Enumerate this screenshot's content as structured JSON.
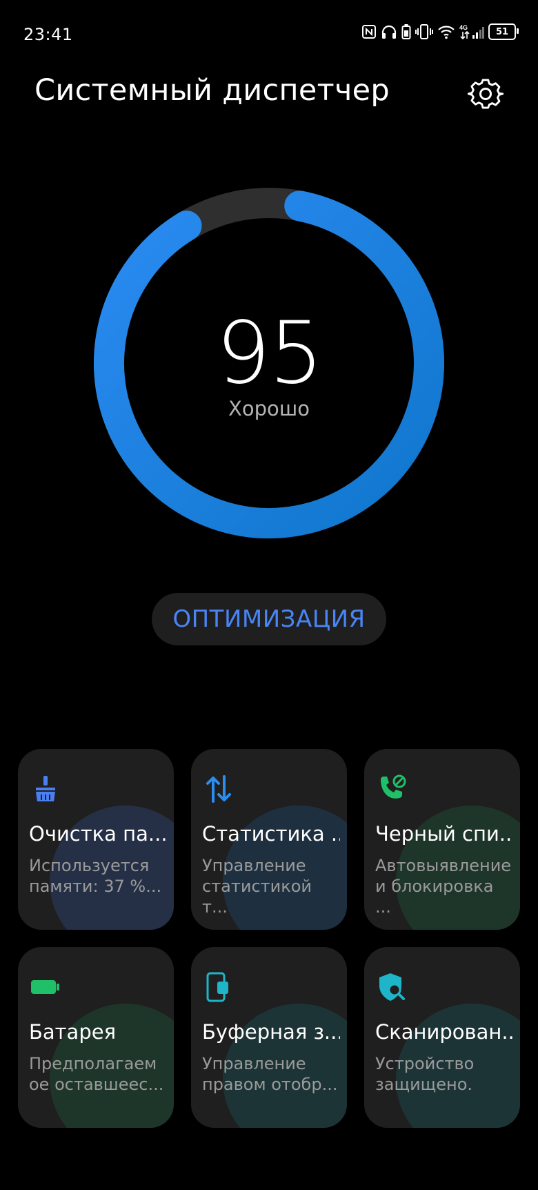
{
  "status_bar": {
    "time": "23:41",
    "battery_level": "51",
    "icons": [
      "nfc-icon",
      "headphones-icon",
      "battery-saver-icon",
      "vibrate-icon",
      "wifi-icon",
      "4g-signal-icon",
      "cell-signal-icon",
      "battery-icon"
    ],
    "network_label": "4G"
  },
  "header": {
    "title": "Системный диспетчер",
    "settings_icon": "gear-icon"
  },
  "score_gauge": {
    "value": "95",
    "status": "Хорошо",
    "fill_fraction": 0.95,
    "colors": {
      "track": "#2f2f2f",
      "fill_start": "#2a87f0",
      "fill_end": "#137bd3"
    }
  },
  "optimize_button": {
    "label": "ОПТИМИЗАЦИЯ",
    "color": "#4a85f5"
  },
  "tiles": [
    {
      "title": "Очистка па...",
      "subtitle_line1": "Используется",
      "subtitle_line2": "памяти: 37 %...",
      "icon": "broom-icon",
      "color": "#4a7ff0"
    },
    {
      "title": "Статистика ...",
      "subtitle_line1": "Управление",
      "subtitle_line2": "статистикой т...",
      "icon": "data-transfer-icon",
      "color": "#2a8ef0"
    },
    {
      "title": "Черный спи...",
      "subtitle_line1": "Автовыявление",
      "subtitle_line2": "и блокировка ...",
      "icon": "blocked-call-icon",
      "color": "#1fc068"
    },
    {
      "title": "Батарея",
      "subtitle_line1": "Предполагаем",
      "subtitle_line2": "ое оставшеес...",
      "icon": "battery-icon",
      "color": "#1fc068"
    },
    {
      "title": "Буферная з...",
      "subtitle_line1": "Управление",
      "subtitle_line2": "правом отобр...",
      "icon": "clipboard-phone-icon",
      "color": "#1fb5c9"
    },
    {
      "title": "Сканирован...",
      "subtitle_line1": "Устройство",
      "subtitle_line2": "защищено.",
      "icon": "shield-search-icon",
      "color": "#1fb5c9"
    }
  ]
}
